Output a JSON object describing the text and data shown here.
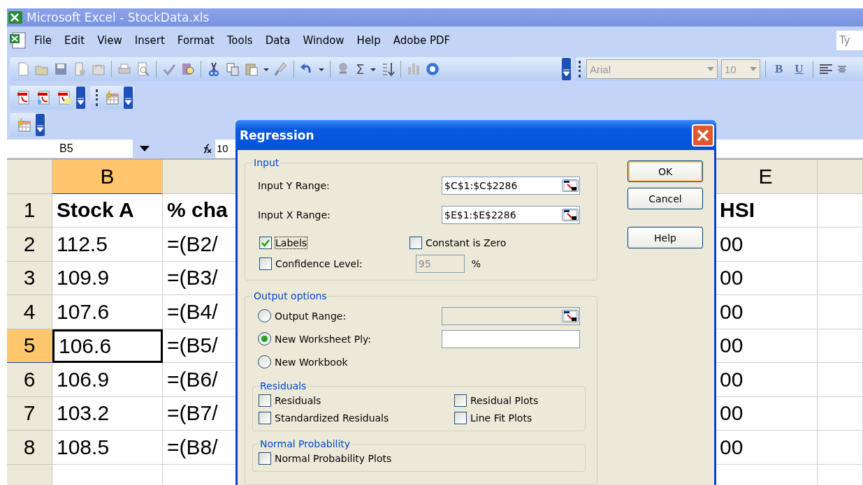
{
  "window": {
    "title": "Microsoft Excel - StockData.xls"
  },
  "menu": [
    "File",
    "Edit",
    "View",
    "Insert",
    "Format",
    "Tools",
    "Data",
    "Window",
    "Help",
    "Adobe PDF"
  ],
  "help_box": {
    "placeholder": "Ty"
  },
  "toolbar": {
    "sum": "Σ",
    "font": "Arial",
    "size": "10",
    "bold": "B",
    "underline": "U"
  },
  "formula_bar": {
    "name_box": "B5",
    "formula": "10"
  },
  "grid": {
    "columns": [
      {
        "label": "B",
        "selected": true
      },
      {
        "selected": false
      },
      {
        "label": "E",
        "selected": false
      }
    ],
    "rows": [
      {
        "header": "1",
        "kind": "heading",
        "selected": false,
        "cells": [
          "Stock A",
          "% cha",
          "HSI"
        ]
      },
      {
        "header": "2",
        "kind": "data",
        "selected": false,
        "cells": [
          "112.5",
          "=(B2/",
          "00"
        ]
      },
      {
        "header": "3",
        "kind": "data",
        "selected": false,
        "cells": [
          "109.9",
          "=(B3/",
          "00"
        ]
      },
      {
        "header": "4",
        "kind": "data",
        "selected": false,
        "cells": [
          "107.6",
          "=(B4/",
          "00"
        ]
      },
      {
        "header": "5",
        "kind": "data",
        "selected": true,
        "cells": [
          "106.6",
          "=(B5/",
          "00"
        ]
      },
      {
        "header": "6",
        "kind": "data",
        "selected": false,
        "cells": [
          "106.9",
          "=(B6/",
          "00"
        ]
      },
      {
        "header": "7",
        "kind": "data",
        "selected": false,
        "cells": [
          "103.2",
          "=(B7/",
          "00"
        ]
      },
      {
        "header": "8",
        "kind": "data",
        "selected": false,
        "cells": [
          "108.5",
          "=(B8/",
          "00"
        ]
      }
    ]
  },
  "dialog": {
    "title": "Regression",
    "input": {
      "legend": "Input",
      "y_range": {
        "label": "Input Y Range:",
        "value": "$C$1:$C$2286"
      },
      "x_range": {
        "label": "Input X Range:",
        "value": "$E$1:$E$2286"
      },
      "labels": {
        "label": "Labels",
        "checked": true
      },
      "constant_zero": {
        "label": "Constant is Zero",
        "checked": false
      },
      "confidence": {
        "label": "Confidence Level:",
        "checked": false,
        "value": "95",
        "disabled": true,
        "unit": "%"
      }
    },
    "buttons": [
      {
        "label": "OK",
        "default": true
      },
      {
        "label": "Cancel",
        "default": false
      },
      {
        "label": "Help",
        "default": false
      }
    ],
    "output": {
      "legend": "Output options",
      "options": [
        {
          "label": "Output Range:",
          "selected": false,
          "kind": "range"
        },
        {
          "label": "New Worksheet Ply:",
          "selected": true,
          "kind": "text"
        },
        {
          "label": "New Workbook",
          "selected": false,
          "kind": "plain"
        }
      ],
      "residuals": {
        "legend": "Residuals",
        "items": [
          {
            "label": "Residuals",
            "checked": false
          },
          {
            "label": "Residual Plots",
            "checked": false
          },
          {
            "label": "Standardized Residuals",
            "checked": false
          },
          {
            "label": "Line Fit Plots",
            "checked": false
          }
        ]
      },
      "normal": {
        "legend": "Normal Probability",
        "items": [
          {
            "label": "Normal Probability Plots",
            "checked": false
          }
        ]
      }
    }
  }
}
